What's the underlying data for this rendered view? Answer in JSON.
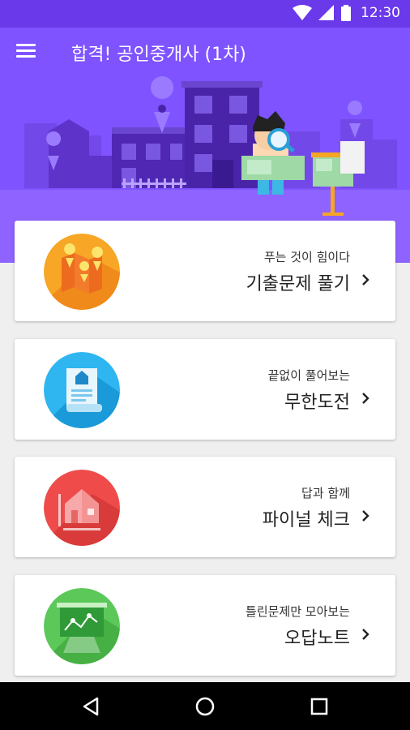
{
  "status_bar": {
    "time": "12:30"
  },
  "app_bar": {
    "title": "합격! 공인중개사 (1차)"
  },
  "cards": [
    {
      "subtitle": "푸는 것이 힘이다",
      "title": "기출문제 풀기",
      "icon": "map-pins-icon"
    },
    {
      "subtitle": "끝없이 풀어보는",
      "title": "무한도전",
      "icon": "house-document-icon"
    },
    {
      "subtitle": "답과 함께",
      "title": "파이널 체크",
      "icon": "house-blueprint-icon"
    },
    {
      "subtitle": "틀린문제만 모아보는",
      "title": "오답노트",
      "icon": "chart-board-icon"
    }
  ],
  "nav": {
    "back": "back-icon",
    "home": "home-icon",
    "recents": "recents-icon"
  },
  "colors": {
    "status_bar": "#6a39ea",
    "hero": "#7f53ff",
    "background": "#efeff0"
  }
}
